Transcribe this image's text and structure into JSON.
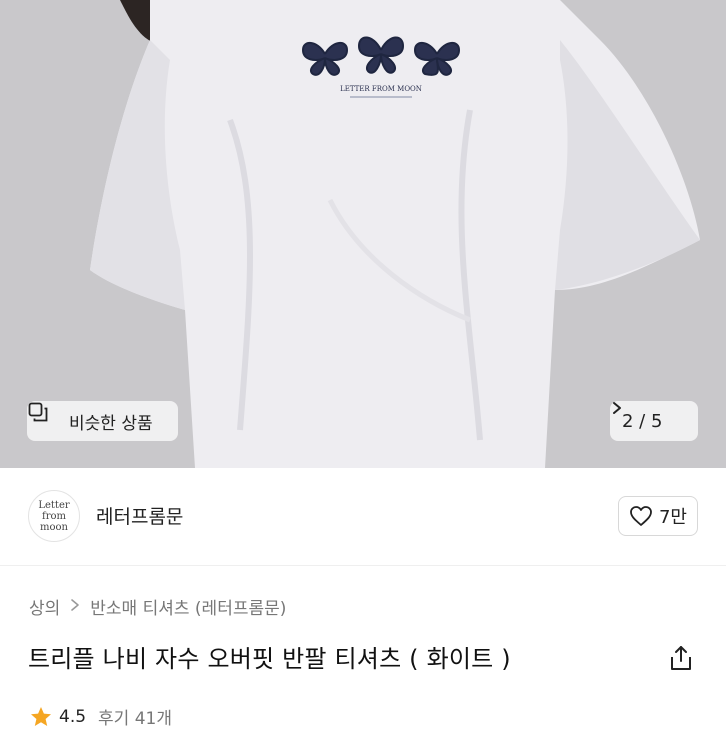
{
  "hero": {
    "similar_label": "비슷한 상품",
    "similar_icon": "copy-icon",
    "counter": "2 / 5",
    "counter_icon": "chevron-right-icon",
    "shirt_print_text": "LETTER FROM MOON"
  },
  "shop": {
    "logo_text": "Letter\nfrom\nmoon",
    "name": "레터프롬문",
    "like_count": "7만",
    "like_icon": "heart-icon"
  },
  "breadcrumb": {
    "category": "상의",
    "subcategory": "반소매 티셔츠 (레터프롬문)"
  },
  "product": {
    "title": "트리플 나비 자수 오버핏 반팔 티셔츠 ( 화이트 )",
    "share_icon": "share-icon"
  },
  "rating": {
    "score": "4.5",
    "reviews": "후기 41개",
    "star_color": "#f5a623"
  }
}
